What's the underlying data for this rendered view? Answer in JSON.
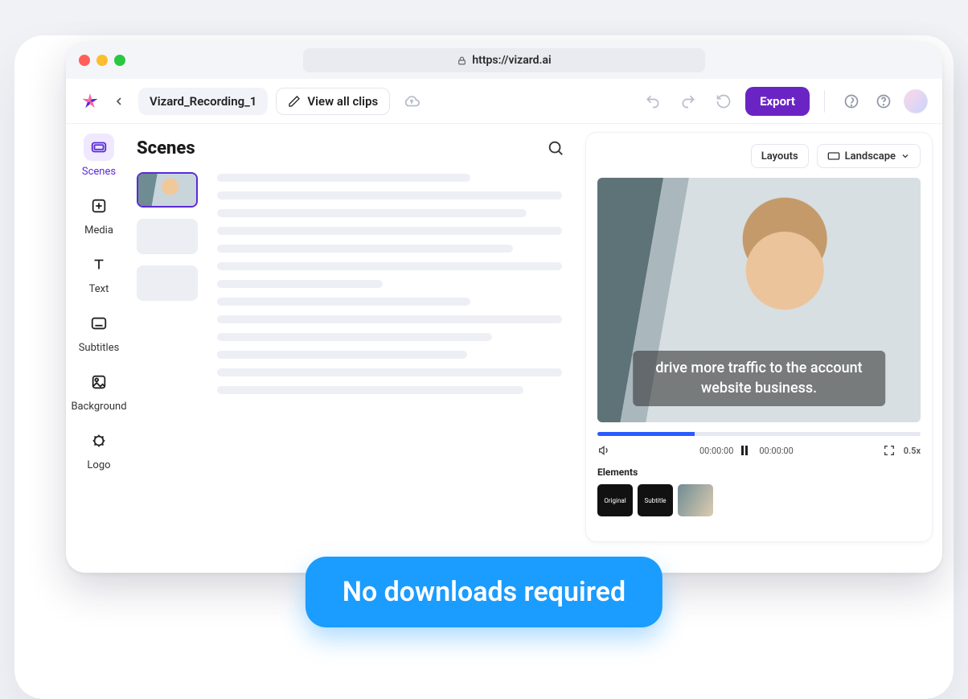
{
  "browser": {
    "url": "https://vizard.ai"
  },
  "toolbar": {
    "filename": "Vizard_Recording_1",
    "view_all_clips": "View all clips",
    "export": "Export"
  },
  "nav": {
    "items": [
      {
        "id": "scenes",
        "label": "Scenes"
      },
      {
        "id": "media",
        "label": "Media"
      },
      {
        "id": "text",
        "label": "Text"
      },
      {
        "id": "subtitles",
        "label": "Subtitles"
      },
      {
        "id": "background",
        "label": "Background"
      },
      {
        "id": "logo",
        "label": "Logo"
      }
    ]
  },
  "scenes_panel": {
    "title": "Scenes",
    "skeleton_widths_pct": [
      72,
      98,
      88,
      98,
      84,
      98,
      47,
      72,
      98,
      78,
      71,
      98,
      87
    ]
  },
  "preview": {
    "layouts_label": "Layouts",
    "orientation_label": "Landscape",
    "caption": "drive more traffic to the account website business.",
    "time_left": "00:00:00",
    "time_right": "00:00:00",
    "speed": "0.5x",
    "elements_label": "Elements",
    "elements": [
      {
        "label": "Original"
      },
      {
        "label": "Subtitle"
      },
      {
        "label": ""
      }
    ]
  },
  "banner": {
    "text": "No downloads required"
  }
}
